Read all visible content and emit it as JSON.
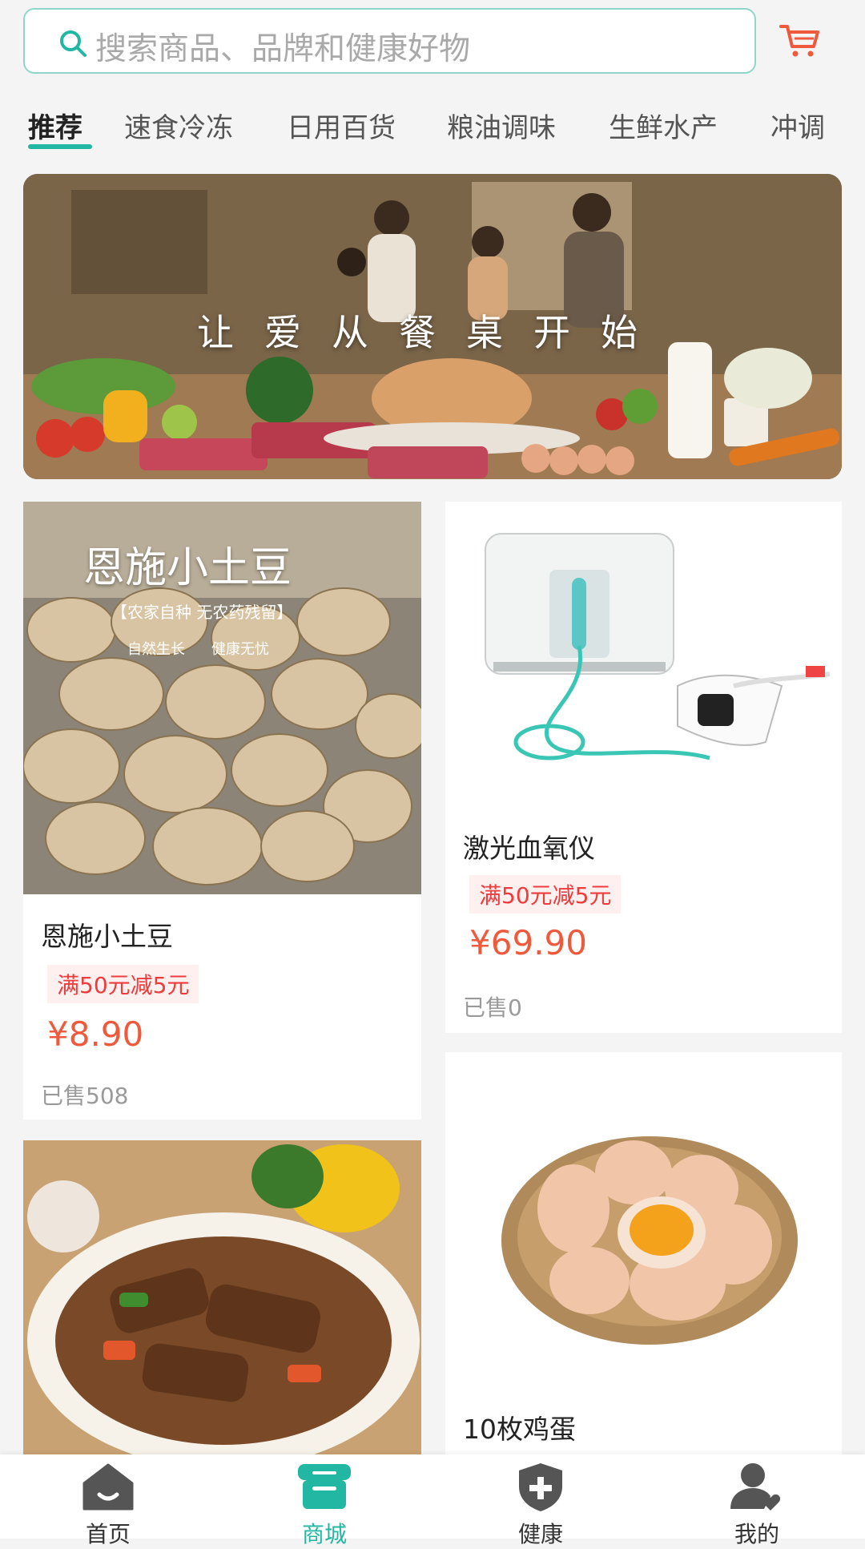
{
  "search": {
    "placeholder": "搜索商品、品牌和健康好物",
    "icon": "search-icon",
    "cart_icon": "cart-icon",
    "accent": "#22b7a2",
    "cart_color": "#f05a3c"
  },
  "tabs": [
    {
      "label": "推荐",
      "active": true
    },
    {
      "label": "速食冷冻"
    },
    {
      "label": "日用百货"
    },
    {
      "label": "粮油调味"
    },
    {
      "label": "生鲜水产"
    },
    {
      "label": "冲调"
    }
  ],
  "banner": {
    "slogan": "让爱从餐桌开始"
  },
  "products": [
    {
      "title": "恩施小土豆",
      "tag": "满50元减5元",
      "price": "¥8.90",
      "sold": "已售508",
      "image_text": {
        "heading": "恩施小土豆",
        "subheading": "【农家自种 无农药残留】",
        "line1": "自然生长",
        "line2": "健康无忧"
      }
    },
    {
      "title": "激光血氧仪",
      "tag": "满50元减5元",
      "price": "¥69.90",
      "sold": "已售0"
    },
    {
      "title": "10枚鸡蛋"
    },
    {
      "title": ""
    }
  ],
  "bottom_nav": [
    {
      "label": "首页",
      "icon": "home-icon"
    },
    {
      "label": "商城",
      "icon": "shop-icon",
      "active": true
    },
    {
      "label": "健康",
      "icon": "health-shield-icon"
    },
    {
      "label": "我的",
      "icon": "user-icon"
    }
  ]
}
